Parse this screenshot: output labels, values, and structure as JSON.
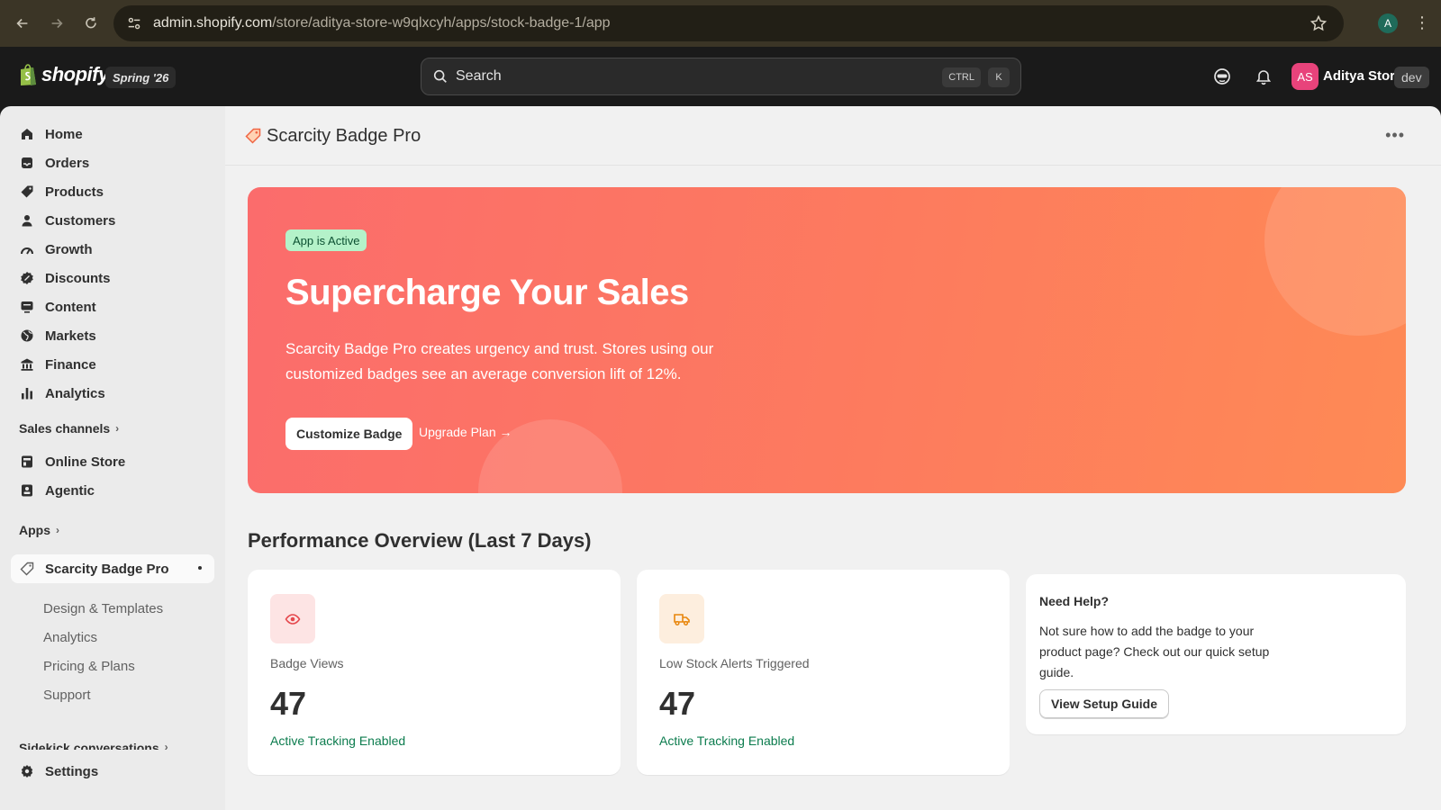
{
  "browser": {
    "url_host": "admin.shopify.com",
    "url_path": "/store/aditya-store-w9qlxcyh/apps/stock-badge-1/app",
    "profile_initial": "A"
  },
  "topbar": {
    "logo_text": "shopify",
    "edition_badge": "Spring '26",
    "search_placeholder": "Search",
    "shortcut_ctrl": "CTRL",
    "shortcut_key": "K",
    "avatar_initials": "AS",
    "avatar_color": "#e8437b",
    "store_name": "Aditya Store",
    "env_badge": "dev"
  },
  "sidebar": {
    "items": [
      {
        "label": "Home",
        "icon": "home-icon"
      },
      {
        "label": "Orders",
        "icon": "inbox-icon"
      },
      {
        "label": "Products",
        "icon": "tag-icon"
      },
      {
        "label": "Customers",
        "icon": "person-icon"
      },
      {
        "label": "Growth",
        "icon": "gauge-icon"
      },
      {
        "label": "Discounts",
        "icon": "discount-icon"
      },
      {
        "label": "Content",
        "icon": "monitor-icon"
      },
      {
        "label": "Markets",
        "icon": "globe-icon"
      },
      {
        "label": "Finance",
        "icon": "bank-icon"
      },
      {
        "label": "Analytics",
        "icon": "bar-chart-icon"
      }
    ],
    "sales_channels_label": "Sales channels",
    "channels": [
      {
        "label": "Online Store",
        "icon": "store-icon"
      },
      {
        "label": "Agentic",
        "icon": "agent-icon"
      }
    ],
    "apps_label": "Apps",
    "active_app": "Scarcity Badge Pro",
    "app_subitems": [
      "Design & Templates",
      "Analytics",
      "Pricing & Plans",
      "Support"
    ],
    "sidekick_label": "Sidekick conversations",
    "settings_label": "Settings"
  },
  "page": {
    "app_title": "Scarcity Badge Pro",
    "more_label": "•••"
  },
  "hero": {
    "status_badge": "App is Active",
    "title": "Supercharge Your Sales",
    "description": "Scarcity Badge Pro creates urgency and trust. Stores using our customized badges see an average conversion lift of 12%.",
    "primary_button": "Customize Badge",
    "secondary_link": "Upgrade Plan →",
    "gradient_start": "#fb6c6c",
    "gradient_end": "#fe8a55"
  },
  "performance": {
    "title": "Performance Overview (Last 7 Days)",
    "cards": [
      {
        "label": "Badge Views",
        "value": "47",
        "note": "Active Tracking Enabled",
        "icon": "eye-icon",
        "icon_color": "#e5484d",
        "icon_bg": "#fde4e4"
      },
      {
        "label": "Low Stock Alerts Triggered",
        "value": "47",
        "note": "Active Tracking Enabled",
        "icon": "truck-icon",
        "icon_color": "#e8860c",
        "icon_bg": "#fdeede"
      }
    ]
  },
  "help": {
    "title": "Need Help?",
    "text": "Not sure how to add the badge to your product page? Check out our quick setup guide.",
    "button": "View Setup Guide"
  }
}
